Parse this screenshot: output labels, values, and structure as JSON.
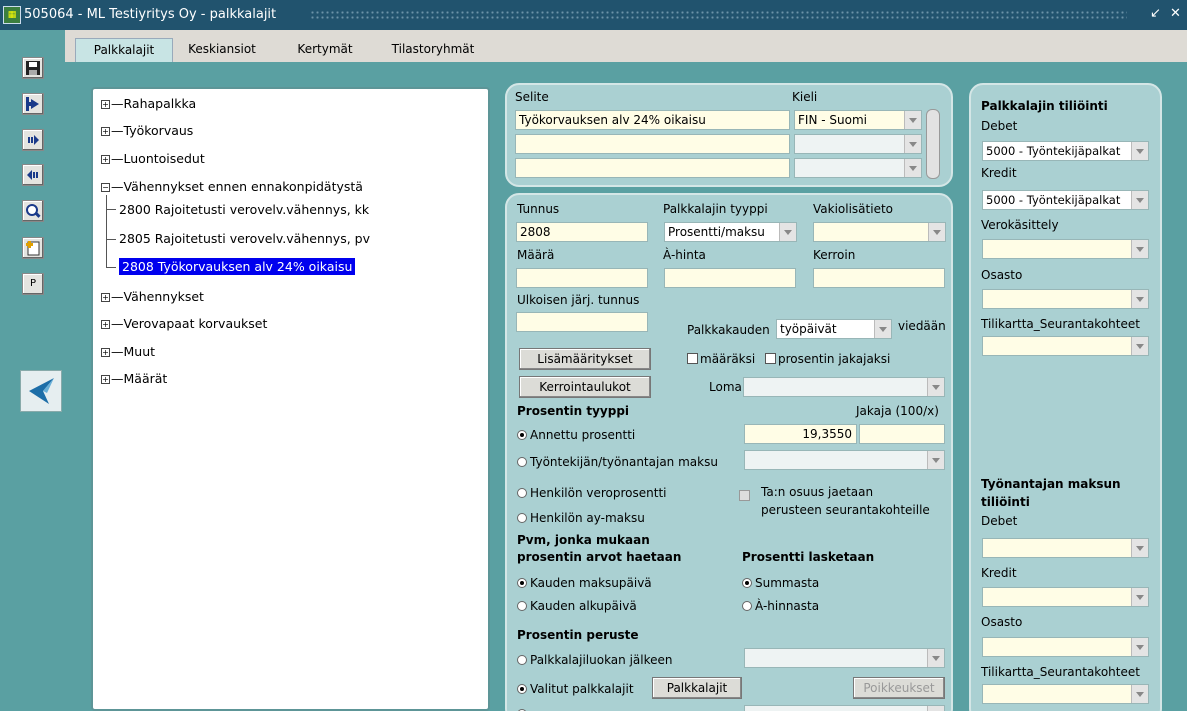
{
  "window": {
    "title": "505064 - ML Testiyritys Oy - palkkalajit",
    "controls": [
      "↙",
      "✕"
    ]
  },
  "tabs": [
    "Palkkalajit",
    "Keskiansiot",
    "Kertymät",
    "Tilastoryhmät"
  ],
  "toolbar": {
    "p_label": "P",
    "icons": [
      "save-icon",
      "exit-icon",
      "forward-icon",
      "back-icon",
      "search-icon",
      "new-document-icon"
    ]
  },
  "tree": {
    "groups": [
      "Rahapalkka",
      "Työkorvaus",
      "Luontoisedut",
      "Vähennykset ennen ennakonpidätystä",
      "Vähennykset",
      "Verovapaat korvaukset",
      "Muut",
      "Määrät"
    ],
    "children": [
      "2800 Rajoitetusti verovelv.vähennys, kk",
      "2805 Rajoitetusti verovelv.vähennys, pv",
      "2808 Työkorvauksen alv 24% oikaisu"
    ]
  },
  "selite": {
    "label": "Selite",
    "kieli_label": "Kieli",
    "rows": [
      {
        "text": "Työkorvauksen alv 24% oikaisu",
        "lang": "FIN - Suomi"
      },
      {
        "text": "",
        "lang": ""
      },
      {
        "text": "",
        "lang": ""
      }
    ]
  },
  "form": {
    "tunnus_label": "Tunnus",
    "tunnus": "2808",
    "tyyppi_label": "Palkkalajin tyyppi",
    "tyyppi": "Prosentti/maksu",
    "vakio_label": "Vakiolisätieto",
    "vakio": "",
    "maara_label": "Määrä",
    "maara": "",
    "ahinta_label": "À-hinta",
    "ahinta": "",
    "kerroin_label": "Kerroin",
    "kerroin": "",
    "ulk_label": "Ulkoisen järj. tunnus",
    "ulk": "",
    "palkkakauden_label": "Palkkakauden",
    "palkkakauden": "työpäivät",
    "viedaan_label": "viedään",
    "lisa_btn": "Lisämääritykset",
    "maaraksi": "määräksi",
    "prosentin_jakajaksi": "prosentin jakajaksi",
    "kerroin_btn": "Kerrointaulukot",
    "loma_label": "Loma",
    "loma": "",
    "prosentin_tyyppi": "Prosentin tyyppi",
    "jakaja_label": "Jakaja (100/x)",
    "annettu": "Annettu prosentti",
    "annettu_value": "19,3550",
    "tyontekijan": "Työntekijän/työnantajan maksu",
    "veroprosentti": "Henkilön veroprosentti",
    "aymaksu": "Henkilön ay-maksu",
    "osuus_line1": "Ta:n osuus jaetaan",
    "osuus_line2": "perusteen seurantakohteille",
    "pvm_line1": "Pvm, jonka mukaan",
    "pvm_line2": "prosentin arvot haetaan",
    "maksupaiva": "Kauden maksupäivä",
    "alkupaiva": "Kauden alkupäivä",
    "lasketaan": "Prosentti lasketaan",
    "summasta": "Summasta",
    "ahinnasta": "À-hinnasta",
    "peruste": "Prosentin peruste",
    "luokan": "Palkkalajiluokan jälkeen",
    "valitut": "Valitut palkkalajit",
    "palkkalajit_btn": "Palkkalajit",
    "poikkeukset_btn": "Poikkeukset"
  },
  "right": {
    "title": "Palkkalajin tiliöinti",
    "debet_label": "Debet",
    "debet": "5000 - Työntekijäpalkat",
    "kredit_label": "Kredit",
    "kredit": "5000 - Työntekijäpalkat",
    "vero_label": "Verokäsittely",
    "osasto_label": "Osasto",
    "tilikartta_label": "Tilikartta_Seurantakohteet",
    "ta_line1": "Työnantajan maksun",
    "ta_line2": "tiliöinti",
    "ta_debet": "Debet",
    "ta_kredit": "Kredit",
    "ta_osasto": "Osasto",
    "ta_tilikartta": "Tilikartta_Seurantakohteet"
  },
  "colors": {
    "background": "#5aa0a2",
    "panel": "#aad0d2",
    "titlebar": "#21536e",
    "selection": "#0000ee",
    "field": "#fffde6"
  }
}
